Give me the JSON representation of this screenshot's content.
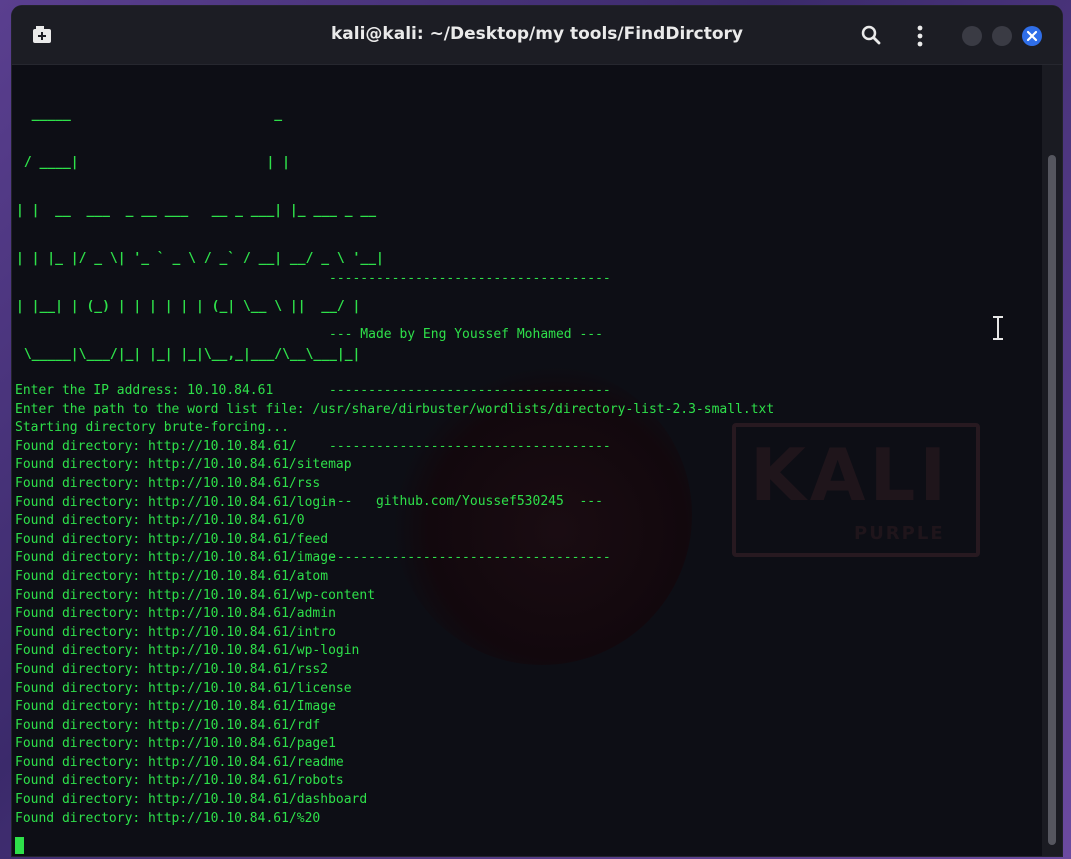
{
  "window": {
    "title": "kali@kali: ~/Desktop/my tools/FindDirctory"
  },
  "icons": {
    "new_tab": "new-tab-icon",
    "search": "search-icon",
    "menu": "kebab-menu-icon",
    "minimize": "minimize-icon",
    "maximize": "maximize-icon",
    "close": "close-icon"
  },
  "colors": {
    "terminal_text": "#2ee04a",
    "close_button": "#2f6ee8"
  },
  "watermark": {
    "big": "KALI",
    "small": "PURPLE"
  },
  "banner": [
    "  _____                          _          ",
    " / ____|                        | |         ",
    "| |  __  ___  _ __ ___   __ _ ___| |_ ___ _ __ ",
    "| | |_ |/ _ \\| '_ ` _ \\ / _` / __| __/ _ \\ '__|",
    "| |__| | (_) | | | | | | (_| \\__ \\ ||  __/ |   ",
    " \\_____|\\___/|_| |_| |_|\\__,_|___/\\__\\___|_|   "
  ],
  "credits": [
    "------------------------------------",
    "--- Made by Eng Youssef Mohamed ---",
    "------------------------------------",
    "------------------------------------",
    "---   github.com/Youssef530245  ---",
    "------------------------------------"
  ],
  "output": [
    "Enter the IP address: 10.10.84.61",
    "Enter the path to the word list file: /usr/share/dirbuster/wordlists/directory-list-2.3-small.txt",
    "Starting directory brute-forcing...",
    "Found directory: http://10.10.84.61/",
    "Found directory: http://10.10.84.61/sitemap",
    "Found directory: http://10.10.84.61/rss",
    "Found directory: http://10.10.84.61/login",
    "Found directory: http://10.10.84.61/0",
    "Found directory: http://10.10.84.61/feed",
    "Found directory: http://10.10.84.61/image",
    "Found directory: http://10.10.84.61/atom",
    "Found directory: http://10.10.84.61/wp-content",
    "Found directory: http://10.10.84.61/admin",
    "Found directory: http://10.10.84.61/intro",
    "Found directory: http://10.10.84.61/wp-login",
    "Found directory: http://10.10.84.61/rss2",
    "Found directory: http://10.10.84.61/license",
    "Found directory: http://10.10.84.61/Image",
    "Found directory: http://10.10.84.61/rdf",
    "Found directory: http://10.10.84.61/page1",
    "Found directory: http://10.10.84.61/readme",
    "Found directory: http://10.10.84.61/robots",
    "Found directory: http://10.10.84.61/dashboard",
    "Found directory: http://10.10.84.61/%20"
  ]
}
